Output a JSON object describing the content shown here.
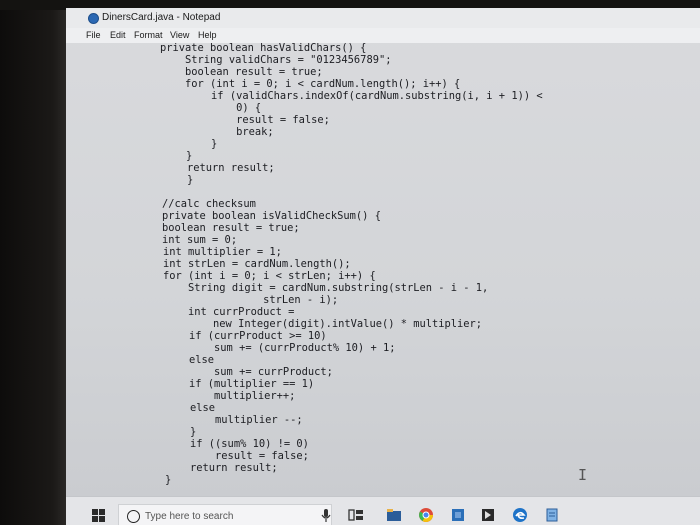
{
  "window": {
    "title": "DinersCard.java - Notepad"
  },
  "menu": [
    {
      "label": "File"
    },
    {
      "label": "Edit"
    },
    {
      "label": "Format"
    },
    {
      "label": "View"
    },
    {
      "label": "Help"
    }
  ],
  "code_lines": [
    "private boolean hasValidChars() {",
    "    String validChars = \"0123456789\";",
    "    boolean result = true;",
    "    for (int i = 0; i < cardNum.length(); i++) {",
    "        if (validChars.indexOf(cardNum.substring(i, i + 1)) <",
    "            0) {",
    "            result = false;",
    "            break;",
    "        }",
    "    }",
    "    return result;",
    "    }",
    "",
    "//calc checksum",
    "private boolean isValidCheckSum() {",
    "boolean result = true;",
    "int sum = 0;",
    "int multiplier = 1;",
    "int strLen = cardNum.length();",
    "for (int i = 0; i < strLen; i++) {",
    "    String digit = cardNum.substring(strLen - i - 1,",
    "                strLen - i);",
    "    int currProduct =",
    "        new Integer(digit).intValue() * multiplier;",
    "    if (currProduct >= 10)",
    "        sum += (currProduct% 10) + 1;",
    "    else",
    "        sum += currProduct;",
    "    if (multiplier == 1)",
    "        multiplier++;",
    "    else",
    "        multiplier --;",
    "    }",
    "    if ((sum% 10) != 0)",
    "        result = false;",
    "    return result;",
    "}"
  ],
  "taskbar": {
    "search_placeholder": "Type here to search",
    "icons": [
      "windows-start-icon",
      "cortana-icon",
      "microphone-icon",
      "task-view-icon",
      "file-explorer-icon",
      "chrome-icon",
      "store-icon",
      "app-icon",
      "edge-icon",
      "notepad-taskbar-icon"
    ],
    "colors": {
      "chrome": "#dd4b39",
      "edge": "#1e73c8",
      "store": "#2b6fb8",
      "explorer": "#e8b24a"
    }
  }
}
